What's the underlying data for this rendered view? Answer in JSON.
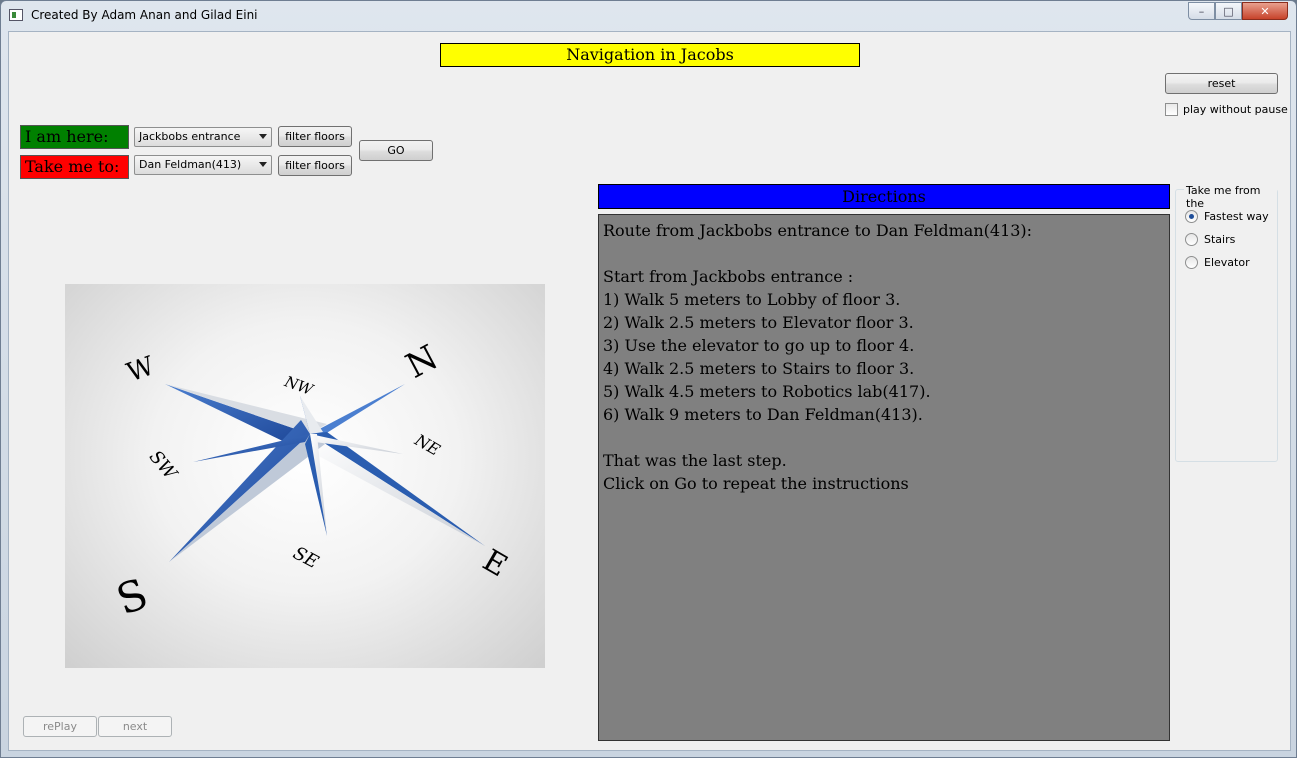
{
  "window": {
    "title": "Created By Adam Anan and Gilad Eini",
    "minimize": "–",
    "maximize": "□",
    "close": "✕"
  },
  "header": {
    "title": "Navigation in Jacobs"
  },
  "controls": {
    "reset_label": "reset",
    "play_without_pause_label": "play without pause",
    "play_without_pause_checked": false,
    "i_am_here_label": "I am here:",
    "take_me_to_label": "Take me to:",
    "from_value": "Jackbobs entrance",
    "to_value": "Dan Feldman(413)",
    "filter_floors_label": "filter floors",
    "go_label": "GO",
    "replay_label": "rePlay",
    "next_label": "next"
  },
  "compass": {
    "labels": {
      "n": "N",
      "s": "S",
      "e": "E",
      "w": "W",
      "nw": "NW",
      "ne": "NE",
      "sw": "SW",
      "se": "SE"
    },
    "accent_color": "#2a5db0"
  },
  "directions": {
    "header": "Directions",
    "lines": [
      "Route from Jackbobs entrance to Dan Feldman(413):",
      "",
      "Start from Jackbobs entrance :",
      "1) Walk 5 meters to Lobby of floor 3.",
      "2) Walk 2.5 meters to Elevator floor 3.",
      "3) Use the elevator to go up to floor 4.",
      "4) Walk 2.5 meters to Stairs to floor 3.",
      "5) Walk 4.5 meters to Robotics lab(417).",
      "6) Walk 9 meters to Dan Feldman(413).",
      "",
      "That was the last step.",
      "Click on Go to repeat the instructions"
    ]
  },
  "route_options": {
    "title": "Take me from the",
    "options": [
      "Fastest way",
      "Stairs",
      "Elevator"
    ],
    "selected": "Fastest way"
  }
}
